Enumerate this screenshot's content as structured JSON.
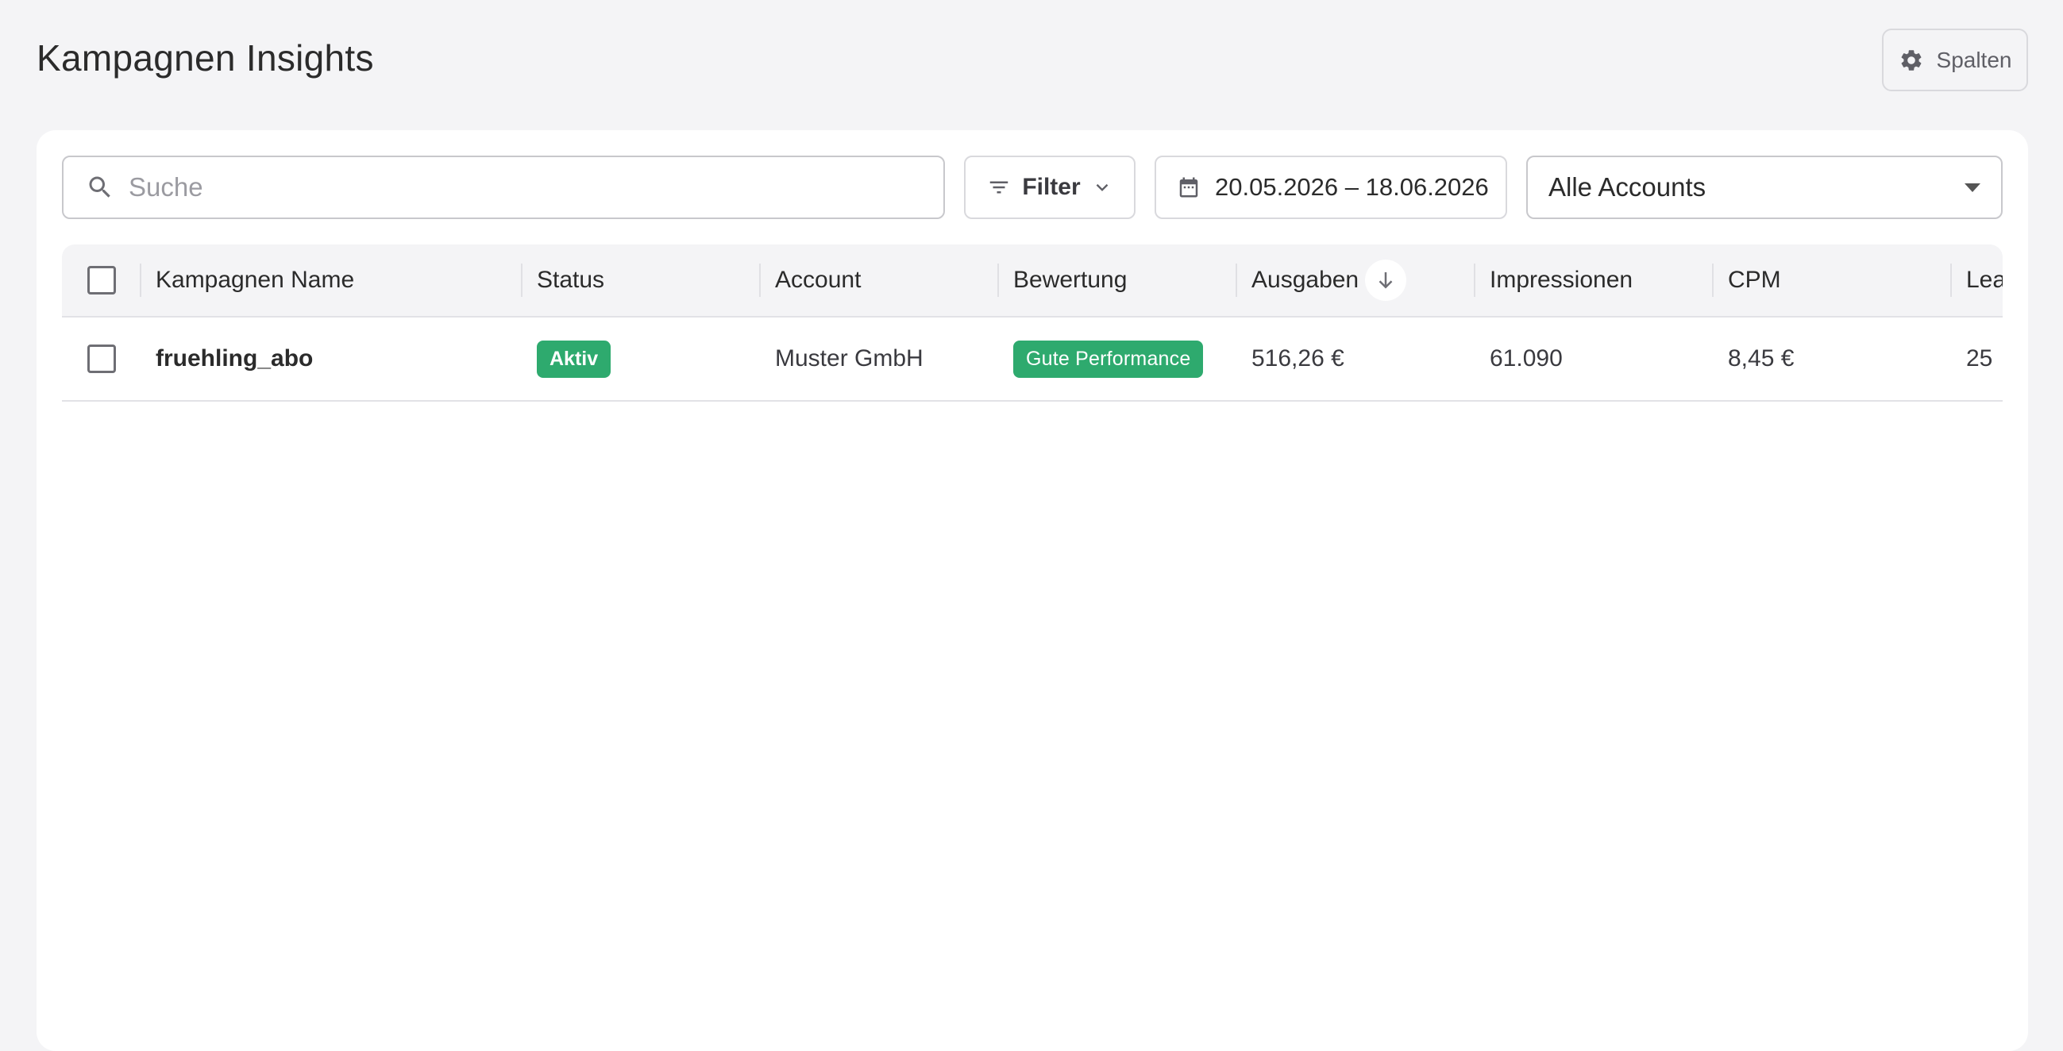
{
  "header": {
    "title": "Kampagnen Insights",
    "columns_button_label": "Spalten"
  },
  "toolbar": {
    "search_placeholder": "Suche",
    "search_value": "",
    "filter_label": "Filter",
    "date_range": "20.05.2026 – 18.06.2026",
    "account_select_value": "Alle Accounts"
  },
  "table": {
    "columns": [
      {
        "label": "Kampagnen Name"
      },
      {
        "label": "Status"
      },
      {
        "label": "Account"
      },
      {
        "label": "Bewertung"
      },
      {
        "label": "Ausgaben",
        "sorted": "desc"
      },
      {
        "label": "Impressionen"
      },
      {
        "label": "CPM"
      },
      {
        "label": "Lea"
      }
    ],
    "rows": [
      {
        "name": "fruehling_abo",
        "status": "Aktiv",
        "account": "Muster GmbH",
        "rating": "Gute Performance",
        "spend": "516,26 €",
        "impressions": "61.090",
        "cpm": "8,45 €",
        "leads": "25"
      }
    ]
  },
  "colors": {
    "accent_green": "#2eaa6e",
    "background": "#f4f4f6"
  },
  "icons": {
    "columns_button": "gear-icon",
    "search": "search-icon",
    "filter": "filter-lines-icon",
    "filter_dropdown": "chevron-down-icon",
    "date": "calendar-icon",
    "account_dropdown": "caret-down-icon",
    "sort": "arrow-down-icon"
  }
}
